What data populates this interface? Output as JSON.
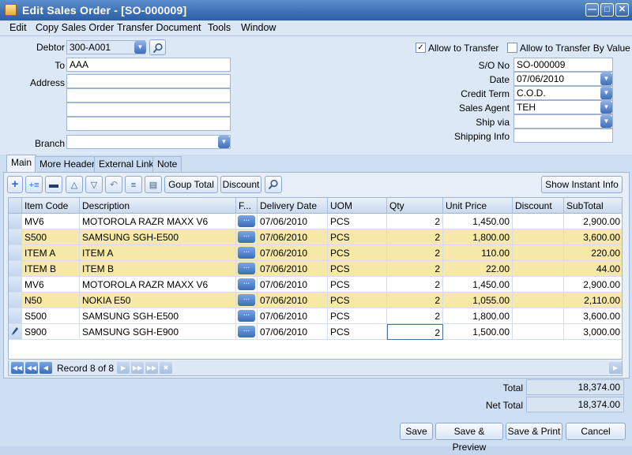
{
  "window": {
    "title": "Edit Sales Order - [SO-000009]"
  },
  "menu": [
    "Edit",
    "Copy Sales Order",
    "Transfer Document",
    "Tools",
    "Window"
  ],
  "header": {
    "debtor_label": "Debtor",
    "debtor_value": "300-A001",
    "to_label": "To",
    "to_value": "AAA",
    "address_label": "Address",
    "address_lines": [
      "",
      "",
      "",
      ""
    ],
    "branch_label": "Branch",
    "branch_value": "",
    "allow_transfer_label": "Allow to Transfer",
    "allow_transfer_checked": true,
    "allow_transfer_by_value_label": "Allow to Transfer By Value",
    "allow_transfer_by_value_checked": false,
    "so_no_label": "S/O No",
    "so_no_value": "SO-000009",
    "date_label": "Date",
    "date_value": "07/06/2010",
    "credit_term_label": "Credit Term",
    "credit_term_value": "C.O.D.",
    "sales_agent_label": "Sales Agent",
    "sales_agent_value": "TEH",
    "ship_via_label": "Ship via",
    "ship_via_value": "",
    "shipping_info_label": "Shipping Info",
    "shipping_info_value": ""
  },
  "tabs": [
    "Main",
    "More Header",
    "External Link",
    "Note"
  ],
  "toolbar": {
    "group_total_label": "Goup Total",
    "discount_label": "Discount",
    "show_instant_info_label": "Show Instant Info"
  },
  "grid": {
    "columns": [
      "Item Code",
      "Description",
      "F...",
      "Delivery Date",
      "UOM",
      "Qty",
      "Unit Price",
      "Discount",
      "SubTotal"
    ],
    "rows": [
      {
        "item_code": "MV6",
        "description": "MOTOROLA RAZR MAXX V6",
        "delivery_date": "07/06/2010",
        "uom": "PCS",
        "qty": "2",
        "unit_price": "1,450.00",
        "discount": "",
        "subtotal": "2,900.00",
        "highlight": false
      },
      {
        "item_code": "S500",
        "description": "SAMSUNG SGH-E500",
        "delivery_date": "07/06/2010",
        "uom": "PCS",
        "qty": "2",
        "unit_price": "1,800.00",
        "discount": "",
        "subtotal": "3,600.00",
        "highlight": true
      },
      {
        "item_code": "ITEM A",
        "description": "ITEM A",
        "delivery_date": "07/06/2010",
        "uom": "PCS",
        "qty": "2",
        "unit_price": "110.00",
        "discount": "",
        "subtotal": "220.00",
        "highlight": true
      },
      {
        "item_code": "ITEM B",
        "description": "ITEM B",
        "delivery_date": "07/06/2010",
        "uom": "PCS",
        "qty": "2",
        "unit_price": "22.00",
        "discount": "",
        "subtotal": "44.00",
        "highlight": true
      },
      {
        "item_code": "MV6",
        "description": "MOTOROLA RAZR MAXX V6",
        "delivery_date": "07/06/2010",
        "uom": "PCS",
        "qty": "2",
        "unit_price": "1,450.00",
        "discount": "",
        "subtotal": "2,900.00",
        "highlight": false
      },
      {
        "item_code": "N50",
        "description": "NOKIA E50",
        "delivery_date": "07/06/2010",
        "uom": "PCS",
        "qty": "2",
        "unit_price": "1,055.00",
        "discount": "",
        "subtotal": "2,110.00",
        "highlight": true
      },
      {
        "item_code": "S500",
        "description": "SAMSUNG SGH-E500",
        "delivery_date": "07/06/2010",
        "uom": "PCS",
        "qty": "2",
        "unit_price": "1,800.00",
        "discount": "",
        "subtotal": "3,600.00",
        "highlight": false
      },
      {
        "item_code": "S900",
        "description": "SAMSUNG SGH-E900",
        "delivery_date": "07/06/2010",
        "uom": "PCS",
        "qty": "2",
        "unit_price": "1,500.00",
        "discount": "",
        "subtotal": "3,000.00",
        "highlight": false
      }
    ],
    "ellipsis_label": "..."
  },
  "navigator": {
    "record_text": "Record 8 of 8"
  },
  "totals": {
    "total_label": "Total",
    "total_value": "18,374.00",
    "net_total_label": "Net Total",
    "net_total_value": "18,374.00"
  },
  "buttons": {
    "save": "Save",
    "save_preview": "Save & Preview",
    "save_print": "Save & Print",
    "cancel": "Cancel"
  }
}
